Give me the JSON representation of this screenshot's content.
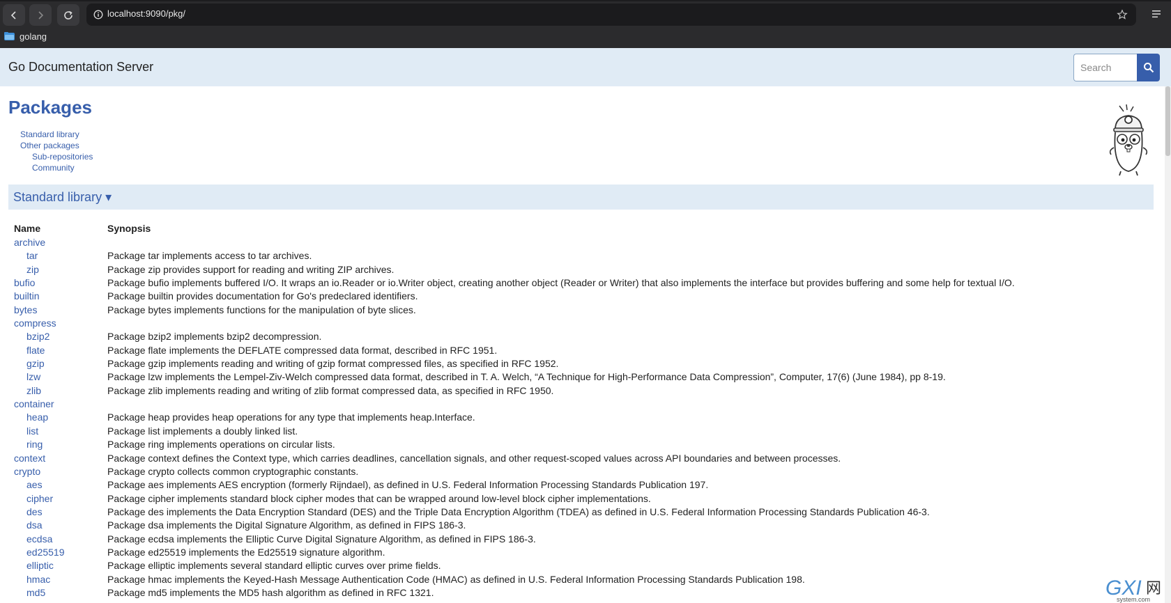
{
  "browser": {
    "url": "localhost:9090/pkg/",
    "bookmark_label": "golang",
    "icons": [
      "back-icon",
      "forward-icon",
      "reload-icon",
      "info-icon",
      "star-icon",
      "menu-icon",
      "folder-icon"
    ]
  },
  "header": {
    "site_title": "Go Documentation Server",
    "search_placeholder": "Search",
    "search_button_icon": "search-icon"
  },
  "page": {
    "title": "Packages",
    "toc": [
      {
        "label": "Standard library",
        "level": 0
      },
      {
        "label": "Other packages",
        "level": 0
      },
      {
        "label": "Sub-repositories",
        "level": 1
      },
      {
        "label": "Community",
        "level": 1
      }
    ],
    "section_title": "Standard library ▾"
  },
  "table": {
    "headers": {
      "name": "Name",
      "synopsis": "Synopsis"
    },
    "rows": [
      {
        "name": "archive",
        "child": false,
        "synopsis": ""
      },
      {
        "name": "tar",
        "child": true,
        "synopsis": "Package tar implements access to tar archives."
      },
      {
        "name": "zip",
        "child": true,
        "synopsis": "Package zip provides support for reading and writing ZIP archives."
      },
      {
        "name": "bufio",
        "child": false,
        "synopsis": "Package bufio implements buffered I/O. It wraps an io.Reader or io.Writer object, creating another object (Reader or Writer) that also implements the interface but provides buffering and some help for textual I/O."
      },
      {
        "name": "builtin",
        "child": false,
        "synopsis": "Package builtin provides documentation for Go's predeclared identifiers."
      },
      {
        "name": "bytes",
        "child": false,
        "synopsis": "Package bytes implements functions for the manipulation of byte slices."
      },
      {
        "name": "compress",
        "child": false,
        "synopsis": ""
      },
      {
        "name": "bzip2",
        "child": true,
        "synopsis": "Package bzip2 implements bzip2 decompression."
      },
      {
        "name": "flate",
        "child": true,
        "synopsis": "Package flate implements the DEFLATE compressed data format, described in RFC 1951."
      },
      {
        "name": "gzip",
        "child": true,
        "synopsis": "Package gzip implements reading and writing of gzip format compressed files, as specified in RFC 1952."
      },
      {
        "name": "lzw",
        "child": true,
        "synopsis": "Package lzw implements the Lempel-Ziv-Welch compressed data format, described in T. A. Welch, “A Technique for High-Performance Data Compression”, Computer, 17(6) (June 1984), pp 8-19."
      },
      {
        "name": "zlib",
        "child": true,
        "synopsis": "Package zlib implements reading and writing of zlib format compressed data, as specified in RFC 1950."
      },
      {
        "name": "container",
        "child": false,
        "synopsis": ""
      },
      {
        "name": "heap",
        "child": true,
        "synopsis": "Package heap provides heap operations for any type that implements heap.Interface."
      },
      {
        "name": "list",
        "child": true,
        "synopsis": "Package list implements a doubly linked list."
      },
      {
        "name": "ring",
        "child": true,
        "synopsis": "Package ring implements operations on circular lists."
      },
      {
        "name": "context",
        "child": false,
        "synopsis": "Package context defines the Context type, which carries deadlines, cancellation signals, and other request-scoped values across API boundaries and between processes."
      },
      {
        "name": "crypto",
        "child": false,
        "synopsis": "Package crypto collects common cryptographic constants."
      },
      {
        "name": "aes",
        "child": true,
        "synopsis": "Package aes implements AES encryption (formerly Rijndael), as defined in U.S. Federal Information Processing Standards Publication 197."
      },
      {
        "name": "cipher",
        "child": true,
        "synopsis": "Package cipher implements standard block cipher modes that can be wrapped around low-level block cipher implementations."
      },
      {
        "name": "des",
        "child": true,
        "synopsis": "Package des implements the Data Encryption Standard (DES) and the Triple Data Encryption Algorithm (TDEA) as defined in U.S. Federal Information Processing Standards Publication 46-3."
      },
      {
        "name": "dsa",
        "child": true,
        "synopsis": "Package dsa implements the Digital Signature Algorithm, as defined in FIPS 186-3."
      },
      {
        "name": "ecdsa",
        "child": true,
        "synopsis": "Package ecdsa implements the Elliptic Curve Digital Signature Algorithm, as defined in FIPS 186-3."
      },
      {
        "name": "ed25519",
        "child": true,
        "synopsis": "Package ed25519 implements the Ed25519 signature algorithm."
      },
      {
        "name": "elliptic",
        "child": true,
        "synopsis": "Package elliptic implements several standard elliptic curves over prime fields."
      },
      {
        "name": "hmac",
        "child": true,
        "synopsis": "Package hmac implements the Keyed-Hash Message Authentication Code (HMAC) as defined in U.S. Federal Information Processing Standards Publication 198."
      },
      {
        "name": "md5",
        "child": true,
        "synopsis": "Package md5 implements the MD5 hash algorithm as defined in RFC 1321."
      }
    ]
  },
  "watermark": {
    "text": "GXI网",
    "subtext": "system.com"
  },
  "colors": {
    "accent": "#375eab",
    "header_bg": "#e0ebf5",
    "chrome_bg": "#2b2b2d"
  }
}
